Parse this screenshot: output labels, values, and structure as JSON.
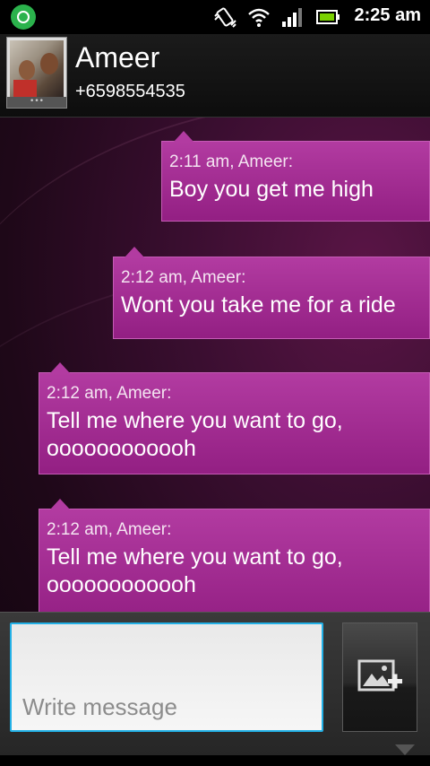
{
  "status_bar": {
    "time": "2:25 am",
    "icons": [
      "whatsapp-icon",
      "vibrate-icon",
      "wifi-icon",
      "signal-icon",
      "battery-icon"
    ]
  },
  "header": {
    "contact_name": "Ameer",
    "contact_number": "+6598554535"
  },
  "messages": [
    {
      "meta": "2:11 am, Ameer:",
      "text": "Boy you get me high"
    },
    {
      "meta": "2:12 am, Ameer:",
      "text": "Wont you take me for a ride"
    },
    {
      "meta": "2:12 am, Ameer:",
      "text": "Tell me where you want to go, oooooooooooh"
    },
    {
      "meta": "2:12 am, Ameer:",
      "text": "Tell me where you want to go, oooooooooooh"
    }
  ],
  "compose": {
    "placeholder": "Write message",
    "attach_icon": "attach-image-icon"
  },
  "colors": {
    "bubble": "#a0278f",
    "accent": "#22b0e6"
  }
}
